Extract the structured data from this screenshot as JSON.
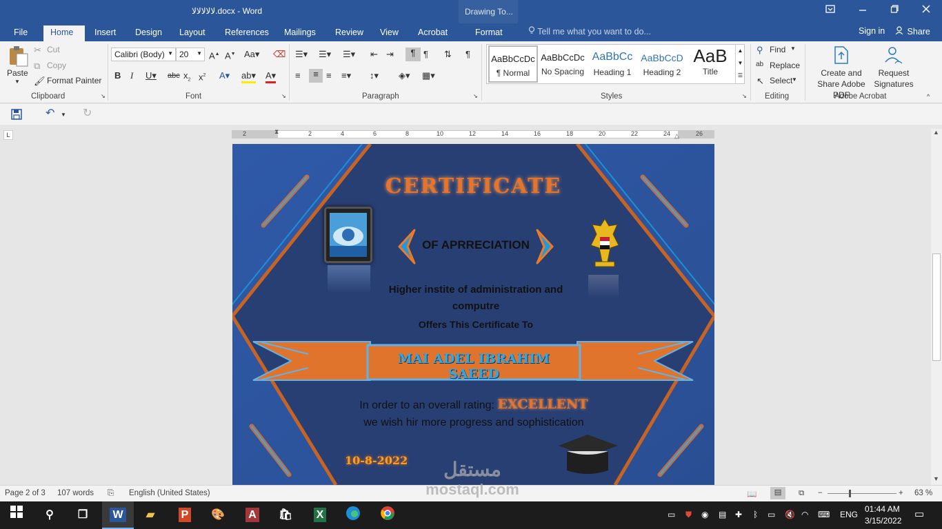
{
  "window": {
    "title": "لالالالالا.docx - Word",
    "context_tab": "Drawing To...",
    "controls": [
      "restore-ribbon",
      "minimize",
      "maximize",
      "close"
    ]
  },
  "tabs": [
    "File",
    "Home",
    "Insert",
    "Design",
    "Layout",
    "References",
    "Mailings",
    "Review",
    "View",
    "Acrobat",
    "Format"
  ],
  "active_tab": "Home",
  "tell_me": "Tell me what you want to do...",
  "sign_in": "Sign in",
  "share": "Share",
  "clipboard": {
    "paste": "Paste",
    "cut": "Cut",
    "copy": "Copy",
    "format_painter": "Format Painter",
    "label": "Clipboard"
  },
  "font": {
    "family": "Calibri (Body)",
    "size": "20",
    "label": "Font"
  },
  "paragraph": {
    "label": "Paragraph"
  },
  "styles": {
    "label": "Styles",
    "items": [
      {
        "preview": "AaBbCcDc",
        "name": "¶ Normal"
      },
      {
        "preview": "AaBbCcDc",
        "name": "No Spacing"
      },
      {
        "preview": "AaBbCc",
        "name": "Heading 1"
      },
      {
        "preview": "AaBbCcD",
        "name": "Heading 2"
      },
      {
        "preview": "AaB",
        "name": "Title"
      }
    ]
  },
  "editing": {
    "find": "Find",
    "replace": "Replace",
    "select": "Select",
    "label": "Editing"
  },
  "acrobat": {
    "create_share": "Create and Share Adobe PDF",
    "request_signatures": "Request Signatures",
    "label": "Adobe Acrobat"
  },
  "ruler_numbers": [
    "2",
    "2",
    "4",
    "6",
    "8",
    "10",
    "12",
    "14",
    "16",
    "18",
    "20",
    "22",
    "24",
    "26"
  ],
  "certificate": {
    "title": "CERTIFICATE",
    "subtitle": "OF APRRECIATION",
    "institute": "Higher instite of administration and computre",
    "offers": "Offers This Certificate To",
    "name": "MAI ADEL IBRAHIM SAEED",
    "rating_prefix": "In order to an overall rating:",
    "rating": "EXCELLENT",
    "wish": "we wish hir more progress and sophistication",
    "date": "10-8-2022"
  },
  "status": {
    "page": "Page 2 of 3",
    "words": "107 words",
    "language": "English (United States)",
    "zoom": "63 %",
    "zoom_percent": 63
  },
  "taskbar": {
    "lang": "ENG",
    "time": "01:44 AM",
    "date": "3/15/2022",
    "watermark_ar": "مستقل",
    "watermark": "mostaql.com"
  }
}
